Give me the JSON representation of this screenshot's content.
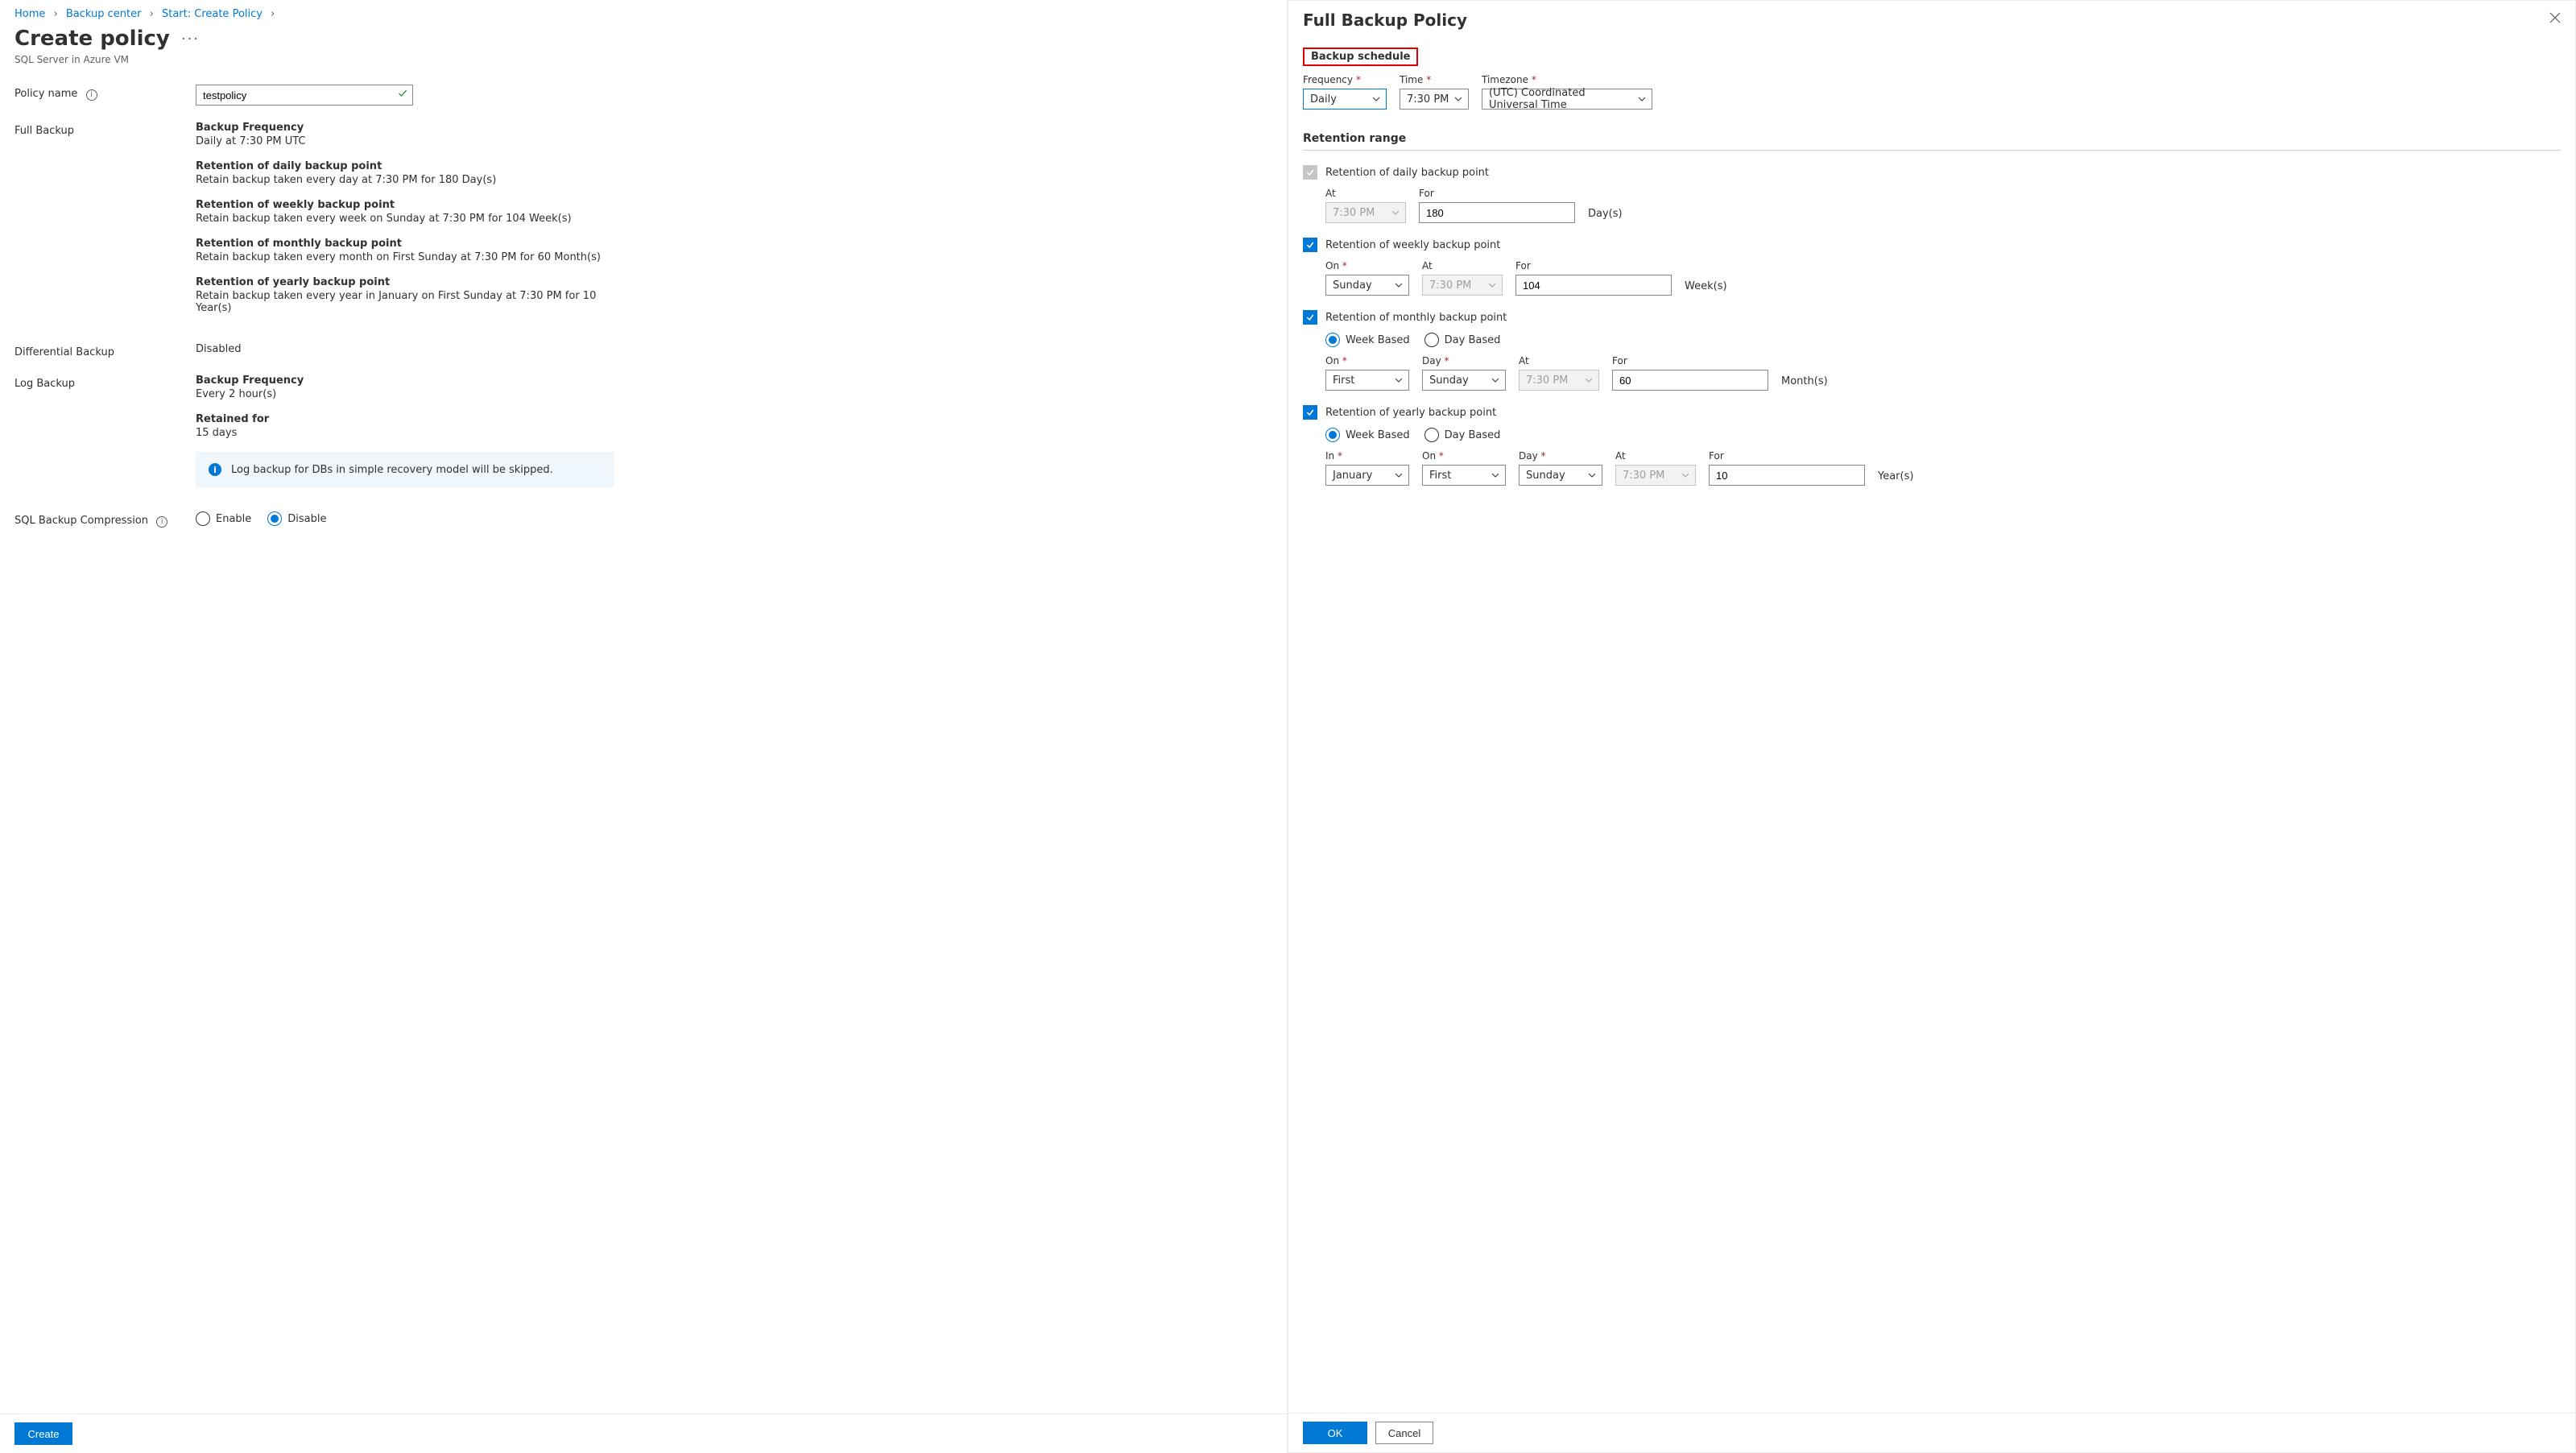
{
  "breadcrumb": {
    "home": "Home",
    "center": "Backup center",
    "start": "Start: Create Policy"
  },
  "leftPane": {
    "title": "Create policy",
    "subtitle": "SQL Server in Azure VM",
    "policyName": {
      "label": "Policy name",
      "value": "testpolicy"
    },
    "fullBackup": {
      "label": "Full Backup",
      "freqTitle": "Backup Frequency",
      "freqValue": "Daily at 7:30 PM UTC",
      "dailyTitle": "Retention of daily backup point",
      "dailyValue": "Retain backup taken every day at 7:30 PM for 180 Day(s)",
      "weeklyTitle": "Retention of weekly backup point",
      "weeklyValue": "Retain backup taken every week on Sunday at 7:30 PM for 104 Week(s)",
      "monthlyTitle": "Retention of monthly backup point",
      "monthlyValue": "Retain backup taken every month on First Sunday at 7:30 PM for 60 Month(s)",
      "yearlyTitle": "Retention of yearly backup point",
      "yearlyValue": "Retain backup taken every year in January on First Sunday at 7:30 PM for 10 Year(s)"
    },
    "diffBackup": {
      "label": "Differential Backup",
      "value": "Disabled"
    },
    "logBackup": {
      "label": "Log Backup",
      "freqTitle": "Backup Frequency",
      "freqValue": "Every 2 hour(s)",
      "retTitle": "Retained for",
      "retValue": "15 days",
      "banner": "Log backup for DBs in simple recovery model will be skipped."
    },
    "compression": {
      "label": "SQL Backup Compression",
      "enable": "Enable",
      "disable": "Disable"
    },
    "createBtn": "Create"
  },
  "rightPane": {
    "title": "Full Backup Policy",
    "scheduleLabel": "Backup schedule",
    "frequency": {
      "label": "Frequency",
      "value": "Daily"
    },
    "time": {
      "label": "Time",
      "value": "7:30 PM"
    },
    "timezone": {
      "label": "Timezone",
      "value": "(UTC) Coordinated Universal Time"
    },
    "retentionHeader": "Retention range",
    "daily": {
      "title": "Retention of daily backup point",
      "atLabel": "At",
      "atValue": "7:30 PM",
      "forLabel": "For",
      "forValue": "180",
      "unit": "Day(s)"
    },
    "weekly": {
      "title": "Retention of weekly backup point",
      "onLabel": "On",
      "onValue": "Sunday",
      "atLabel": "At",
      "atValue": "7:30 PM",
      "forLabel": "For",
      "forValue": "104",
      "unit": "Week(s)"
    },
    "monthly": {
      "title": "Retention of monthly backup point",
      "weekBased": "Week Based",
      "dayBased": "Day Based",
      "onLabel": "On",
      "onValue": "First",
      "dayLabel": "Day",
      "dayValue": "Sunday",
      "atLabel": "At",
      "atValue": "7:30 PM",
      "forLabel": "For",
      "forValue": "60",
      "unit": "Month(s)"
    },
    "yearly": {
      "title": "Retention of yearly backup point",
      "weekBased": "Week Based",
      "dayBased": "Day Based",
      "inLabel": "In",
      "inValue": "January",
      "onLabel": "On",
      "onValue": "First",
      "dayLabel": "Day",
      "dayValue": "Sunday",
      "atLabel": "At",
      "atValue": "7:30 PM",
      "forLabel": "For",
      "forValue": "10",
      "unit": "Year(s)"
    },
    "ok": "OK",
    "cancel": "Cancel"
  }
}
